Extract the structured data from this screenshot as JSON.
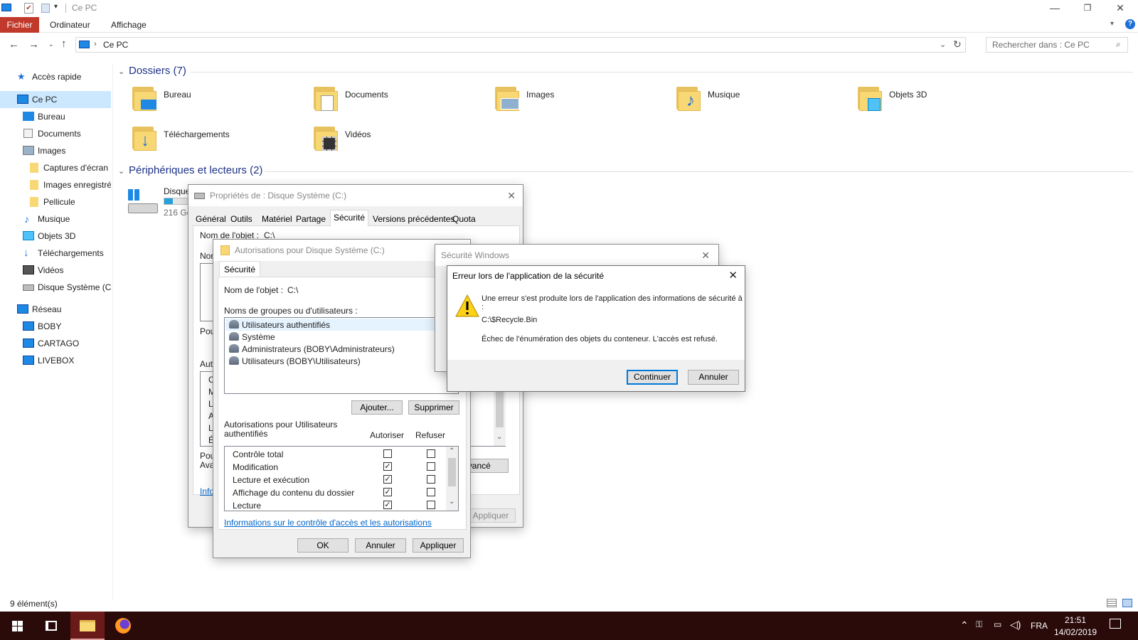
{
  "window": {
    "title": "Ce PC"
  },
  "ribbon": {
    "tabs": [
      "Fichier",
      "Ordinateur",
      "Affichage"
    ]
  },
  "address": {
    "path": "Ce PC",
    "search_placeholder": "Rechercher dans : Ce PC"
  },
  "nav": {
    "quick_access": "Accès rapide",
    "this_pc": "Ce PC",
    "items": [
      "Bureau",
      "Documents",
      "Images",
      "Captures d'écran",
      "Images enregistrées",
      "Pellicule",
      "Musique",
      "Objets 3D",
      "Téléchargements",
      "Vidéos",
      "Disque Système (C:)"
    ],
    "network": "Réseau",
    "network_items": [
      "BOBY",
      "CARTAGO",
      "LIVEBOX"
    ]
  },
  "content": {
    "folders_header": "Dossiers (7)",
    "folders": [
      "Bureau",
      "Documents",
      "Images",
      "Musique",
      "Objets 3D",
      "Téléchargements",
      "Vidéos"
    ],
    "devices_header": "Périphériques et lecteurs (2)",
    "drive_name": "Disque",
    "drive_size": "216 Go"
  },
  "status": {
    "count": "9 élément(s)"
  },
  "props": {
    "title": "Propriétés de : Disque Système (C:)",
    "tabs": [
      "Général",
      "Outils",
      "Matériel",
      "Partage",
      "Sécurité",
      "Versions précédentes",
      "Quota"
    ],
    "object_label": "Nom de l'objet :",
    "object_value": "C:\\",
    "advanced": "Avancé",
    "apply": "Appliquer",
    "partial": [
      "Nom",
      "Pou",
      "Auto",
      "Pou",
      "Ava",
      "Info"
    ],
    "letters": [
      "C",
      "M",
      "L",
      "A",
      "L",
      "É"
    ]
  },
  "perm": {
    "title": "Autorisations pour Disque Système (C:)",
    "tab": "Sécurité",
    "object_label": "Nom de l'objet :",
    "object_value": "C:\\",
    "groups_label": "Noms de groupes ou d'utilisateurs :",
    "groups": [
      "Utilisateurs authentifiés",
      "Système",
      "Administrateurs (BOBY\\Administrateurs)",
      "Utilisateurs (BOBY\\Utilisateurs)"
    ],
    "add": "Ajouter...",
    "remove": "Supprimer",
    "perm_label": "Autorisations pour Utilisateurs authentifiés",
    "allow": "Autoriser",
    "deny": "Refuser",
    "rows": [
      {
        "name": "Contrôle total",
        "allow": false,
        "deny": false
      },
      {
        "name": "Modification",
        "allow": true,
        "deny": false
      },
      {
        "name": "Lecture et exécution",
        "allow": true,
        "deny": false
      },
      {
        "name": "Affichage du contenu du dossier",
        "allow": true,
        "deny": false
      },
      {
        "name": "Lecture",
        "allow": true,
        "deny": false
      }
    ],
    "link": "Informations sur le contrôle d'accès et les autorisations",
    "ok": "OK",
    "cancel": "Annuler",
    "apply": "Appliquer"
  },
  "winsec": {
    "title": "Sécurité Windows"
  },
  "error": {
    "title": "Erreur lors de l'application de la sécurité",
    "line1": "Une erreur s'est produite lors de l'application des informations de sécurité à :",
    "path": "C:\\$Recycle.Bin",
    "line2": "Échec de l'énumération des objets du conteneur. L'accès est refusé.",
    "continue": "Continuer",
    "cancel": "Annuler"
  },
  "tray": {
    "lang": "FRA",
    "time": "21:51",
    "date": "14/02/2019"
  },
  "colors": {
    "ribbon_file": "#c0392b",
    "taskbar": "#2b0a0a",
    "accent": "#0078d7"
  }
}
